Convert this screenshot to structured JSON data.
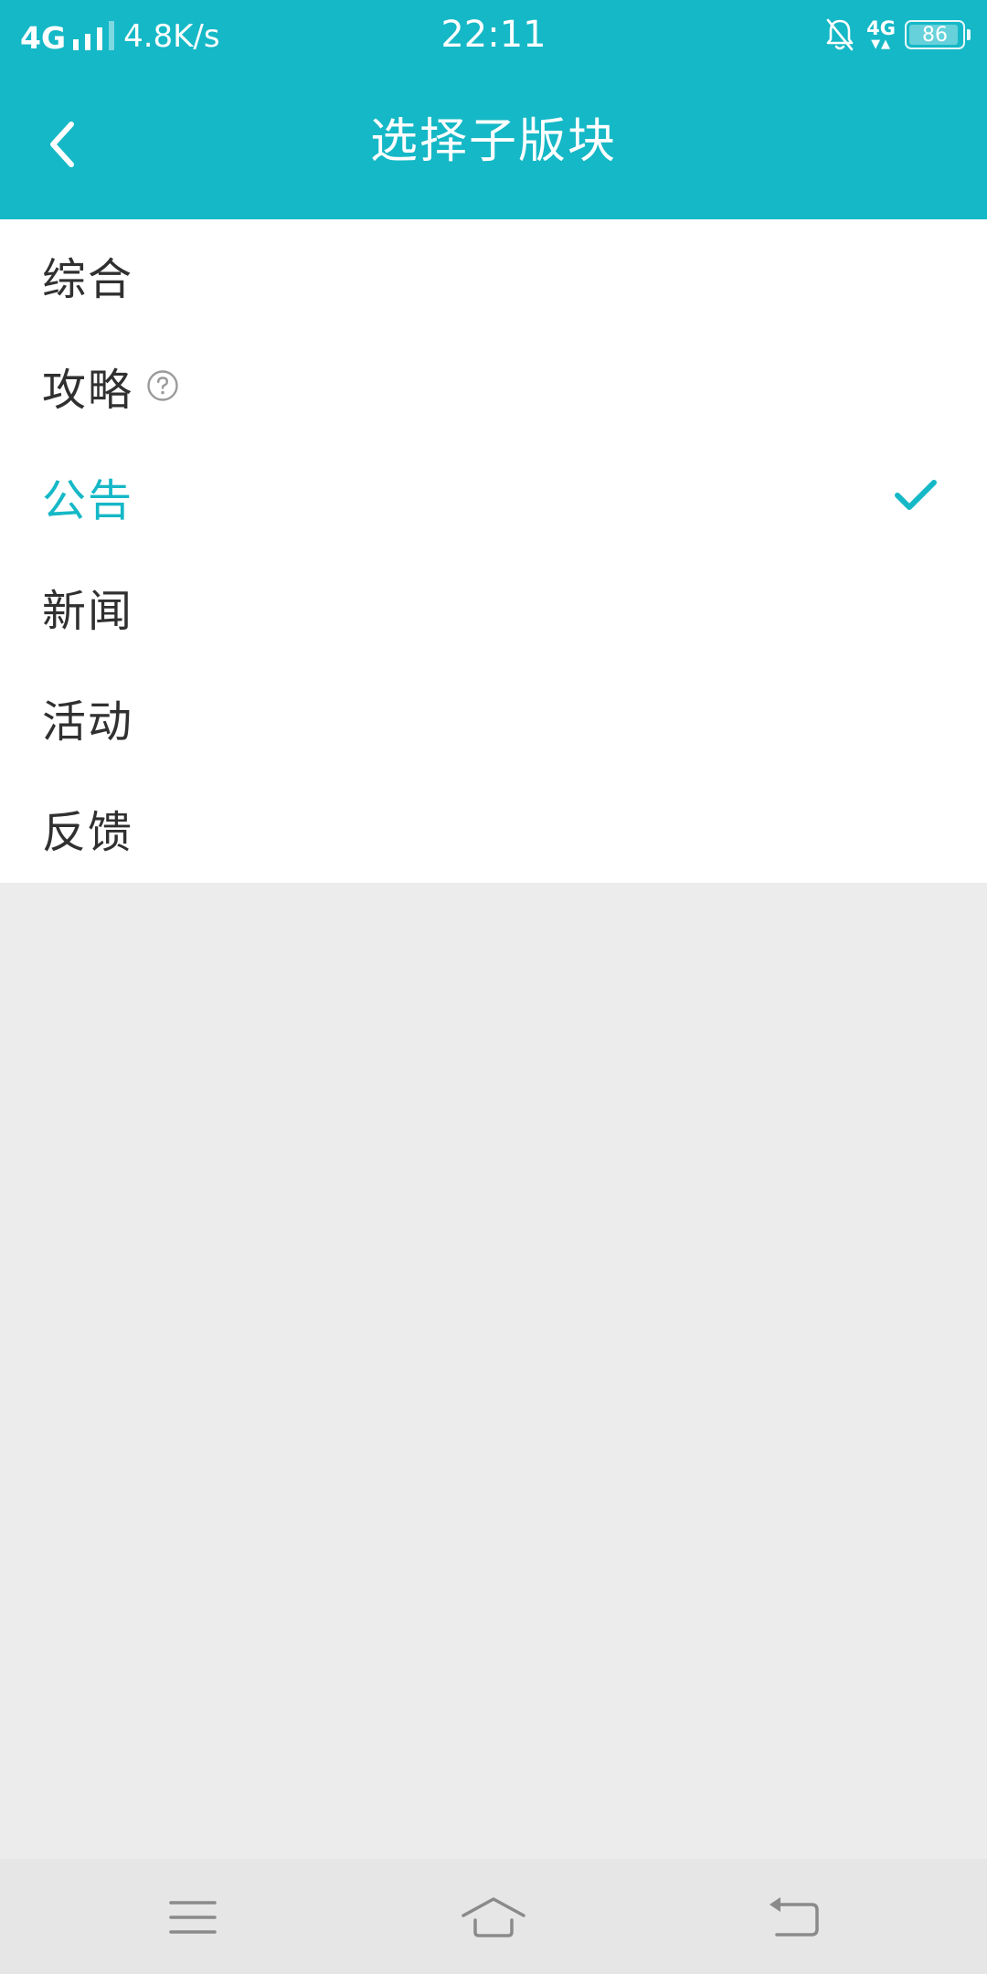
{
  "status_bar": {
    "network_type": "4G",
    "speed": "4.8K/s",
    "time": "22:11",
    "network_small": "4G",
    "battery": "86"
  },
  "header": {
    "title": "选择子版块"
  },
  "sections": [
    {
      "label": "综合",
      "selected": false
    },
    {
      "label": "攻略",
      "selected": false,
      "has_help": true
    },
    {
      "label": "公告",
      "selected": true
    },
    {
      "label": "新闻",
      "selected": false
    },
    {
      "label": "活动",
      "selected": false
    },
    {
      "label": "反馈",
      "selected": false
    }
  ],
  "colors": {
    "accent": "#15b8c6",
    "text": "#303030",
    "background": "#ececec",
    "nav_bar": "#e6e6e6"
  },
  "icons": {
    "back": "chevron-left-icon",
    "help": "question-circle-icon",
    "selected": "check-icon",
    "nav_menu": "menu-icon",
    "nav_home": "home-icon",
    "nav_back": "return-icon"
  }
}
